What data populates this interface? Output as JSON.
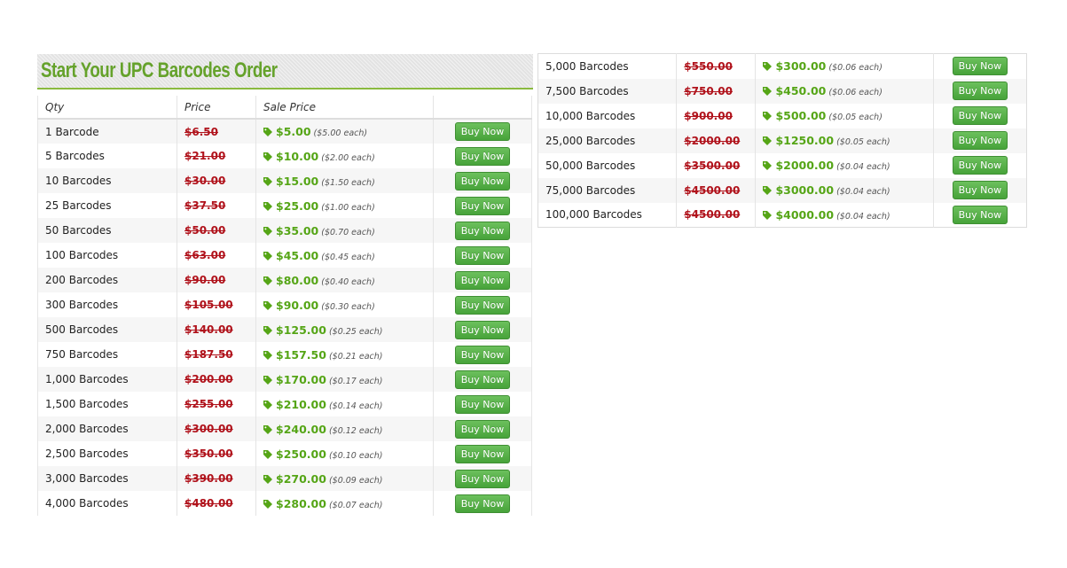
{
  "header": {
    "title": "Start Your UPC Barcodes Order"
  },
  "table": {
    "columns": [
      "Qty",
      "Price",
      "Sale Price",
      ""
    ],
    "buy_label": "Buy Now"
  },
  "left_rows": [
    {
      "qty": "1 Barcode",
      "price": "$6.50",
      "sale": "$5.00",
      "each": "($5.00 each)"
    },
    {
      "qty": "5 Barcodes",
      "price": "$21.00",
      "sale": "$10.00",
      "each": "($2.00 each)"
    },
    {
      "qty": "10 Barcodes",
      "price": "$30.00",
      "sale": "$15.00",
      "each": "($1.50 each)"
    },
    {
      "qty": "25 Barcodes",
      "price": "$37.50",
      "sale": "$25.00",
      "each": "($1.00 each)"
    },
    {
      "qty": "50 Barcodes",
      "price": "$50.00",
      "sale": "$35.00",
      "each": "($0.70 each)"
    },
    {
      "qty": "100 Barcodes",
      "price": "$63.00",
      "sale": "$45.00",
      "each": "($0.45 each)"
    },
    {
      "qty": "200 Barcodes",
      "price": "$90.00",
      "sale": "$80.00",
      "each": "($0.40 each)"
    },
    {
      "qty": "300 Barcodes",
      "price": "$105.00",
      "sale": "$90.00",
      "each": "($0.30 each)"
    },
    {
      "qty": "500 Barcodes",
      "price": "$140.00",
      "sale": "$125.00",
      "each": "($0.25 each)"
    },
    {
      "qty": "750 Barcodes",
      "price": "$187.50",
      "sale": "$157.50",
      "each": "($0.21 each)"
    },
    {
      "qty": "1,000 Barcodes",
      "price": "$200.00",
      "sale": "$170.00",
      "each": "($0.17 each)"
    },
    {
      "qty": "1,500 Barcodes",
      "price": "$255.00",
      "sale": "$210.00",
      "each": "($0.14 each)"
    },
    {
      "qty": "2,000 Barcodes",
      "price": "$300.00",
      "sale": "$240.00",
      "each": "($0.12 each)"
    },
    {
      "qty": "2,500 Barcodes",
      "price": "$350.00",
      "sale": "$250.00",
      "each": "($0.10 each)"
    },
    {
      "qty": "3,000 Barcodes",
      "price": "$390.00",
      "sale": "$270.00",
      "each": "($0.09 each)"
    },
    {
      "qty": "4,000 Barcodes",
      "price": "$480.00",
      "sale": "$280.00",
      "each": "($0.07 each)"
    }
  ],
  "right_rows": [
    {
      "qty": "5,000 Barcodes",
      "price": "$550.00",
      "sale": "$300.00",
      "each": "($0.06 each)"
    },
    {
      "qty": "7,500 Barcodes",
      "price": "$750.00",
      "sale": "$450.00",
      "each": "($0.06 each)"
    },
    {
      "qty": "10,000 Barcodes",
      "price": "$900.00",
      "sale": "$500.00",
      "each": "($0.05 each)"
    },
    {
      "qty": "25,000 Barcodes",
      "price": "$2000.00",
      "sale": "$1250.00",
      "each": "($0.05 each)"
    },
    {
      "qty": "50,000 Barcodes",
      "price": "$3500.00",
      "sale": "$2000.00",
      "each": "($0.04 each)"
    },
    {
      "qty": "75,000 Barcodes",
      "price": "$4500.00",
      "sale": "$3000.00",
      "each": "($0.04 each)"
    },
    {
      "qty": "100,000 Barcodes",
      "price": "$4500.00",
      "sale": "$4000.00",
      "each": "($0.04 each)"
    }
  ],
  "colors": {
    "title": "#65a22b",
    "old_price": "#b0121b",
    "sale_price": "#55a516",
    "button": "#47a33a"
  },
  "icons": {
    "sale": "tag-icon"
  }
}
